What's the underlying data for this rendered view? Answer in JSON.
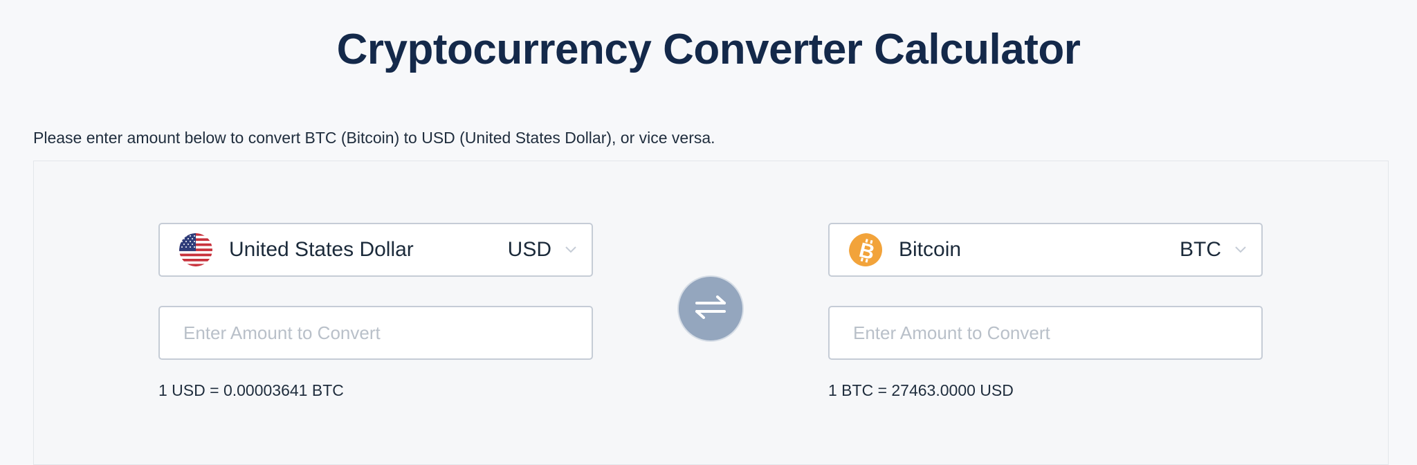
{
  "page": {
    "title": "Cryptocurrency Converter Calculator",
    "instructions": "Please enter amount below to convert BTC (Bitcoin) to USD (United States Dollar), or vice versa."
  },
  "converter": {
    "from": {
      "currency_name": "United States Dollar",
      "currency_code": "USD",
      "icon": "us-flag-icon",
      "amount_value": "",
      "amount_placeholder": "Enter Amount to Convert",
      "rate_text": "1 USD = 0.00003641 BTC"
    },
    "to": {
      "currency_name": "Bitcoin",
      "currency_code": "BTC",
      "icon": "bitcoin-icon",
      "amount_value": "",
      "amount_placeholder": "Enter Amount to Convert",
      "rate_text": "1 BTC = 27463.0000 USD"
    },
    "swap_icon": "swap-arrows-icon"
  },
  "colors": {
    "title": "#14294a",
    "swap_button": "#94a6be",
    "bitcoin": "#f2a33a",
    "border": "#c5ccd6"
  }
}
